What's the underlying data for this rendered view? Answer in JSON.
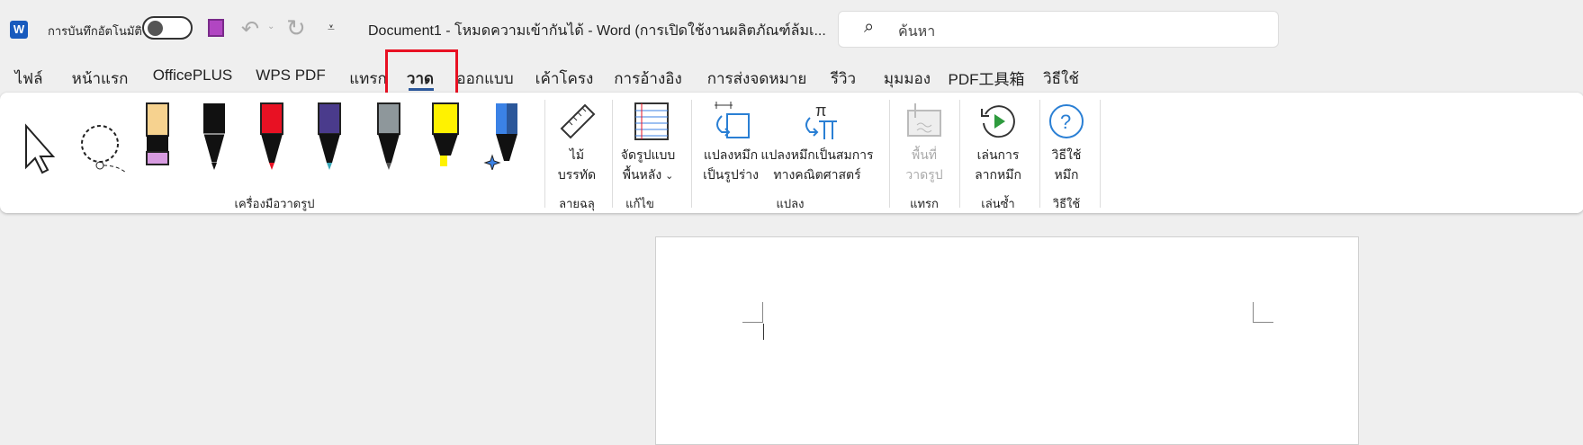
{
  "titlebar": {
    "autosave_label": "การบันทึกอัตโนมัติ",
    "title": "Document1  -  โหมดความเข้ากันได้  -  Word (การเปิดใช้งานผลิตภัณฑ์ล้มเ...",
    "search_placeholder": "ค้นหา"
  },
  "tabs": [
    "ไฟล์",
    "หน้าแรก",
    "OfficePLUS",
    "WPS PDF",
    "แทรก",
    "วาด",
    "ออกแบบ",
    "เค้าโครง",
    "การอ้างอิง",
    "การส่งจดหมาย",
    "รีวิว",
    "มุมมอง",
    "PDF工具箱",
    "วิธีใช้"
  ],
  "active_tab": "วาด",
  "ribbon": {
    "groups": [
      "เครื่องมือวาดรูป",
      "ลายฉลุ",
      "แก้ไข",
      "แปลง",
      "แทรก",
      "เล่นซ้ำ",
      "วิธีใช้"
    ],
    "ruler": [
      "ไม้",
      "บรรทัด"
    ],
    "background": [
      "จัดรูปแบบ",
      "พื้นหลัง"
    ],
    "ink_to_shape": [
      "แปลงหมึก",
      "เป็นรูปร่าง"
    ],
    "ink_to_math": [
      "แปลงหมึกเป็นสมการ",
      "ทางคณิตศาสตร์"
    ],
    "canvas": [
      "พื้นที่",
      "วาดรูป"
    ],
    "replay": [
      "เล่นการ",
      "ลากหมึก"
    ],
    "help": [
      "วิธีใช้",
      "หมึก"
    ]
  },
  "colors": {
    "accent": "#2b579a",
    "highlight": "#e81123"
  }
}
